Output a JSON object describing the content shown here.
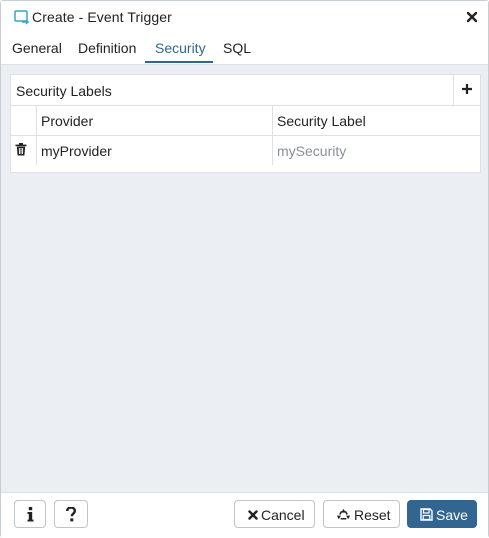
{
  "dialog": {
    "title": "Create - Event Trigger",
    "icons": {
      "title": "event-trigger-icon",
      "close": "close-icon"
    }
  },
  "tabs": [
    {
      "label": "General",
      "active": false
    },
    {
      "label": "Definition",
      "active": false
    },
    {
      "label": "Security",
      "active": true
    },
    {
      "label": "SQL",
      "active": false
    }
  ],
  "security": {
    "section_title": "Security Labels",
    "add_icon": "plus-icon",
    "columns": [
      "Provider",
      "Security Label"
    ],
    "rows": [
      {
        "provider": "myProvider",
        "security_label": "mySecurity",
        "delete_icon": "trash-icon"
      }
    ]
  },
  "footer": {
    "info_icon": "info-icon",
    "help_icon": "question-icon",
    "cancel_label": "Cancel",
    "reset_label": "Reset",
    "save_label": "Save"
  },
  "colors": {
    "accent": "#326690",
    "panel_bg": "#ebeef3",
    "border": "#dde0e6",
    "muted_text": "#8a8f98"
  }
}
